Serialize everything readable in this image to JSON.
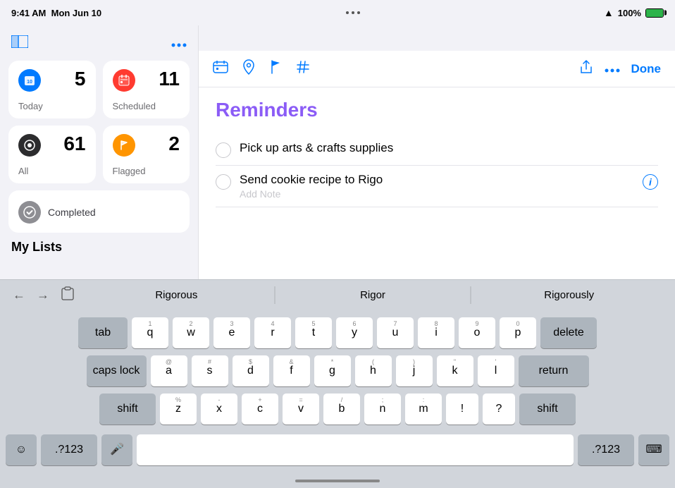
{
  "statusBar": {
    "time": "9:41 AM",
    "date": "Mon Jun 10",
    "dots": 3,
    "wifi": "WiFi",
    "battery": "100%"
  },
  "sidebar": {
    "toggleIcon": "⊞",
    "ellipsisIcon": "···",
    "smartLists": [
      {
        "id": "today",
        "label": "Today",
        "count": "5",
        "icon": "📅",
        "iconClass": "icon-blue"
      },
      {
        "id": "scheduled",
        "label": "Scheduled",
        "count": "11",
        "icon": "📅",
        "iconClass": "icon-red"
      },
      {
        "id": "all",
        "label": "All",
        "count": "61",
        "icon": "●",
        "iconClass": "icon-dark"
      },
      {
        "id": "flagged",
        "label": "Flagged",
        "count": "2",
        "icon": "⚑",
        "iconClass": "icon-orange"
      }
    ],
    "completed": {
      "label": "Completed",
      "icon": "✓",
      "iconClass": "icon-gray"
    },
    "myListsLabel": "My Lists"
  },
  "toolbar": {
    "icons": [
      "🖼",
      "➤",
      "⚑",
      "#"
    ],
    "shareIcon": "↑",
    "ellipsisIcon": "···",
    "doneLabel": "Done"
  },
  "reminders": {
    "title": "Reminders",
    "items": [
      {
        "id": 1,
        "text": "Pick up arts & crafts supplies",
        "completed": false
      },
      {
        "id": 2,
        "text": "Send cookie recipe to Rigo",
        "completed": false,
        "editing": true
      }
    ],
    "addNotePlaceholder": "Add Note"
  },
  "autocorrect": {
    "suggestions": [
      "Rigorous",
      "Rigor",
      "Rigorously"
    ]
  },
  "keyboard": {
    "row1": [
      {
        "label": "q",
        "sub": "1"
      },
      {
        "label": "w",
        "sub": "2"
      },
      {
        "label": "e",
        "sub": "3"
      },
      {
        "label": "r",
        "sub": "4"
      },
      {
        "label": "t",
        "sub": "5"
      },
      {
        "label": "y",
        "sub": "6"
      },
      {
        "label": "u",
        "sub": "7"
      },
      {
        "label": "i",
        "sub": "8"
      },
      {
        "label": "o",
        "sub": "9"
      },
      {
        "label": "p",
        "sub": "0"
      }
    ],
    "row2": [
      {
        "label": "a",
        "sub": "@"
      },
      {
        "label": "s",
        "sub": "#"
      },
      {
        "label": "d",
        "sub": "$"
      },
      {
        "label": "f",
        "sub": "&"
      },
      {
        "label": "g",
        "sub": "*"
      },
      {
        "label": "h",
        "sub": "("
      },
      {
        "label": "j",
        "sub": ")"
      },
      {
        "label": "k",
        "sub": "\""
      },
      {
        "label": "l",
        "sub": "'"
      }
    ],
    "row3": [
      {
        "label": "z",
        "sub": "%"
      },
      {
        "label": "x",
        "sub": "-"
      },
      {
        "label": "c",
        "sub": "+"
      },
      {
        "label": "v",
        "sub": "="
      },
      {
        "label": "b",
        "sub": "/"
      },
      {
        "label": "n",
        "sub": ";"
      },
      {
        "label": "m",
        "sub": ":"
      },
      {
        "label": "!",
        "sub": ""
      },
      {
        "label": "?",
        "sub": ""
      }
    ],
    "tabLabel": "tab",
    "deleteLabel": "delete",
    "capsLockLabel": "caps lock",
    "returnLabel": "return",
    "shiftLabel": "shift",
    "emojiLabel": "☺",
    "numberLabel": ".?123",
    "micLabel": "🎤",
    "spaceLabel": "",
    "numberRightLabel": ".?123",
    "keyboardLabel": "⌨"
  }
}
